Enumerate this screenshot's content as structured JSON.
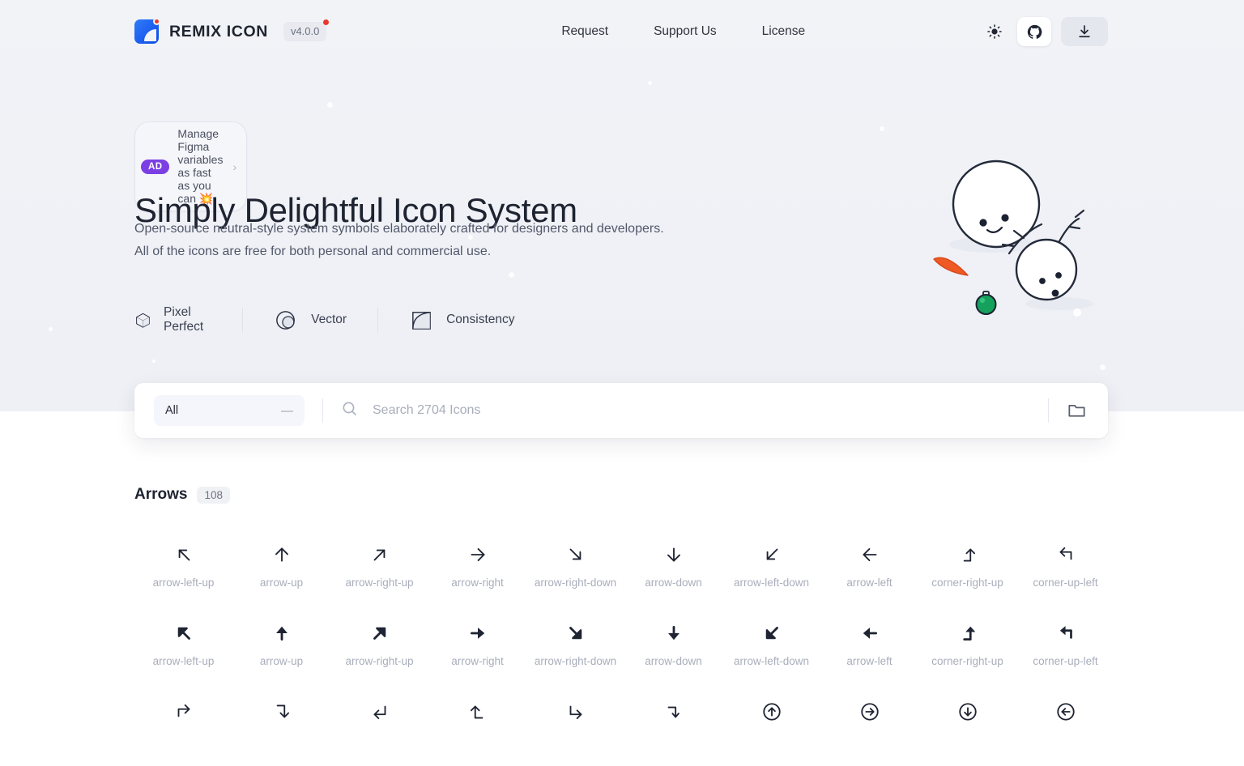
{
  "header": {
    "brand_name": "REMIX ICON",
    "version": "v4.0.0",
    "logo_icon": "remix-logo-icon",
    "nav": [
      {
        "label": "Request"
      },
      {
        "label": "Support Us"
      },
      {
        "label": "License"
      }
    ],
    "actions": [
      {
        "name": "theme-toggle",
        "icon": "sun-icon"
      },
      {
        "name": "github-link",
        "icon": "github-icon"
      },
      {
        "name": "download-button",
        "icon": "download-icon"
      }
    ]
  },
  "hero": {
    "ad": {
      "badge": "AD",
      "text": "Manage Figma variables as fast as you can 💥",
      "chevron": "›"
    },
    "title": "Simply Delightful Icon System",
    "description_lines": [
      "Open-source neutral-style system symbols elaborately crafted for designers and developers.",
      "All of the icons are free for both personal and commercial use."
    ],
    "features": [
      {
        "label": "Pixel Perfect",
        "icon": "cube-icon"
      },
      {
        "label": "Vector",
        "icon": "circles-icon"
      },
      {
        "label": "Consistency",
        "icon": "square-curve-icon"
      }
    ],
    "illustration": "snowman-illustration"
  },
  "search": {
    "category_value": "All",
    "category_chevron": "—",
    "placeholder": "Search 2704 Icons",
    "value": "",
    "search_icon": "search-icon",
    "folder_icon": "folder-icon"
  },
  "catalog": {
    "category_title": "Arrows",
    "category_count": "108",
    "rows": [
      {
        "style": "line",
        "icons": [
          {
            "label": "arrow-left-up",
            "icon": "arrow-left-up-icon"
          },
          {
            "label": "arrow-up",
            "icon": "arrow-up-icon"
          },
          {
            "label": "arrow-right-up",
            "icon": "arrow-right-up-icon"
          },
          {
            "label": "arrow-right",
            "icon": "arrow-right-icon"
          },
          {
            "label": "arrow-right-down",
            "icon": "arrow-right-down-icon"
          },
          {
            "label": "arrow-down",
            "icon": "arrow-down-icon"
          },
          {
            "label": "arrow-left-down",
            "icon": "arrow-left-down-icon"
          },
          {
            "label": "arrow-left",
            "icon": "arrow-left-icon"
          },
          {
            "label": "corner-right-up",
            "icon": "corner-right-up-icon"
          },
          {
            "label": "corner-up-left",
            "icon": "corner-up-left-icon"
          }
        ]
      },
      {
        "style": "fill",
        "icons": [
          {
            "label": "arrow-left-up",
            "icon": "arrow-left-up-fill-icon"
          },
          {
            "label": "arrow-up",
            "icon": "arrow-up-fill-icon"
          },
          {
            "label": "arrow-right-up",
            "icon": "arrow-right-up-fill-icon"
          },
          {
            "label": "arrow-right",
            "icon": "arrow-right-fill-icon"
          },
          {
            "label": "arrow-right-down",
            "icon": "arrow-right-down-fill-icon"
          },
          {
            "label": "arrow-down",
            "icon": "arrow-down-fill-icon"
          },
          {
            "label": "arrow-left-down",
            "icon": "arrow-left-down-fill-icon"
          },
          {
            "label": "arrow-left",
            "icon": "arrow-left-fill-icon"
          },
          {
            "label": "corner-right-up",
            "icon": "corner-right-up-fill-icon"
          },
          {
            "label": "corner-up-left",
            "icon": "corner-up-left-fill-icon"
          }
        ]
      },
      {
        "style": "line",
        "icons": [
          {
            "label": "",
            "icon": "corner-up-right-icon"
          },
          {
            "label": "",
            "icon": "corner-right-down-icon"
          },
          {
            "label": "",
            "icon": "corner-down-left-icon"
          },
          {
            "label": "",
            "icon": "corner-left-up-icon"
          },
          {
            "label": "",
            "icon": "corner-down-right-icon"
          },
          {
            "label": "",
            "icon": "corner-left-down-icon"
          },
          {
            "label": "",
            "icon": "arrow-up-circle-icon"
          },
          {
            "label": "",
            "icon": "arrow-right-circle-icon"
          },
          {
            "label": "",
            "icon": "arrow-down-circle-icon"
          },
          {
            "label": "",
            "icon": "arrow-left-circle-icon"
          }
        ]
      }
    ]
  },
  "colors": {
    "brand_blue": "#1d5ff0",
    "accent_red": "#e8392c",
    "ad_purple": "#7b3fe4",
    "hero_bg": "#f1f2f7",
    "text_dark": "#1d2330",
    "text_muted": "#a9aebb",
    "carrot_orange": "#ef5a24",
    "ornament_green": "#15a05c"
  }
}
